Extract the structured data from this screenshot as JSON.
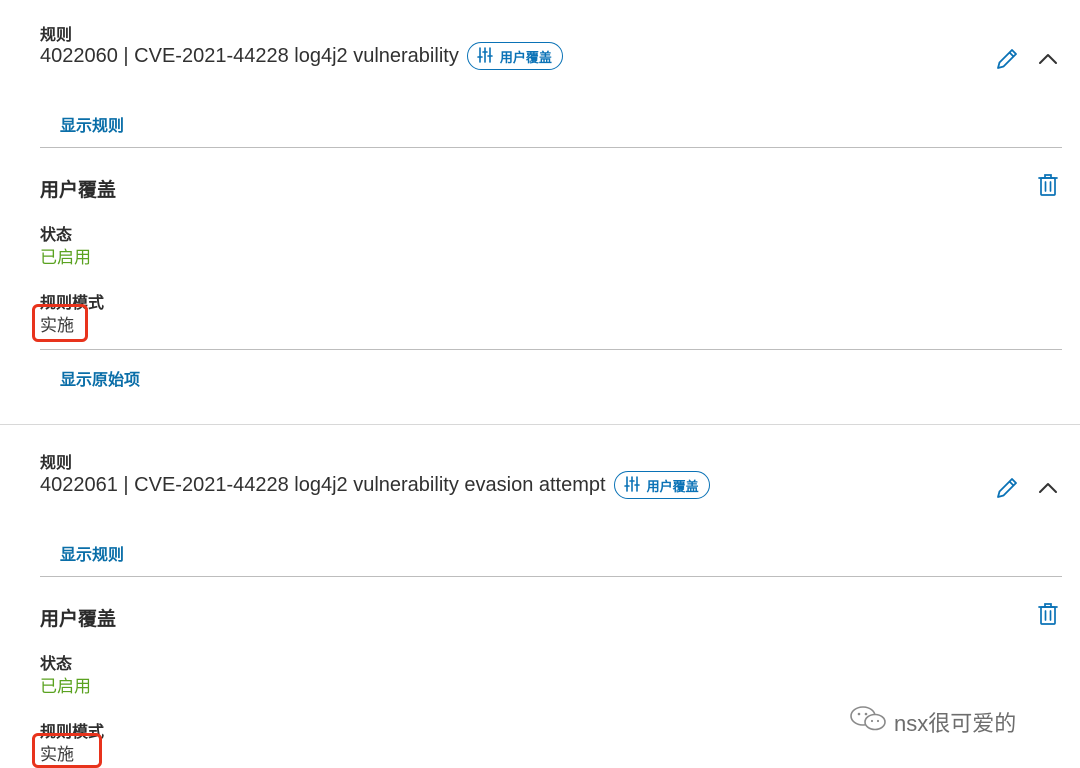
{
  "rules": [
    {
      "section_label": "规则",
      "title": "4022060 | CVE-2021-44228 log4j2 vulnerability",
      "badge": "用户覆盖",
      "show_rule_link": "显示规则",
      "override_title": "用户覆盖",
      "status_label": "状态",
      "status_value": "已启用",
      "mode_label": "规则模式",
      "mode_value": "实施",
      "show_original_link": "显示原始项"
    },
    {
      "section_label": "规则",
      "title": "4022061 | CVE-2021-44228 log4j2 vulnerability evasion attempt",
      "badge": "用户覆盖",
      "show_rule_link": "显示规则",
      "override_title": "用户覆盖",
      "status_label": "状态",
      "status_value": "已启用",
      "mode_label": "规则模式",
      "mode_value": "实施"
    }
  ],
  "watermark": {
    "text": "nsx很可爱的"
  },
  "colors": {
    "accent": "#0a72b6",
    "link": "#0a6ea8",
    "status_enabled": "#5aa220",
    "highlight_box": "#e8331c"
  },
  "icons": [
    "sliders-icon",
    "edit-pencil-icon",
    "chevron-up-icon",
    "trash-icon",
    "wechat-icon"
  ]
}
